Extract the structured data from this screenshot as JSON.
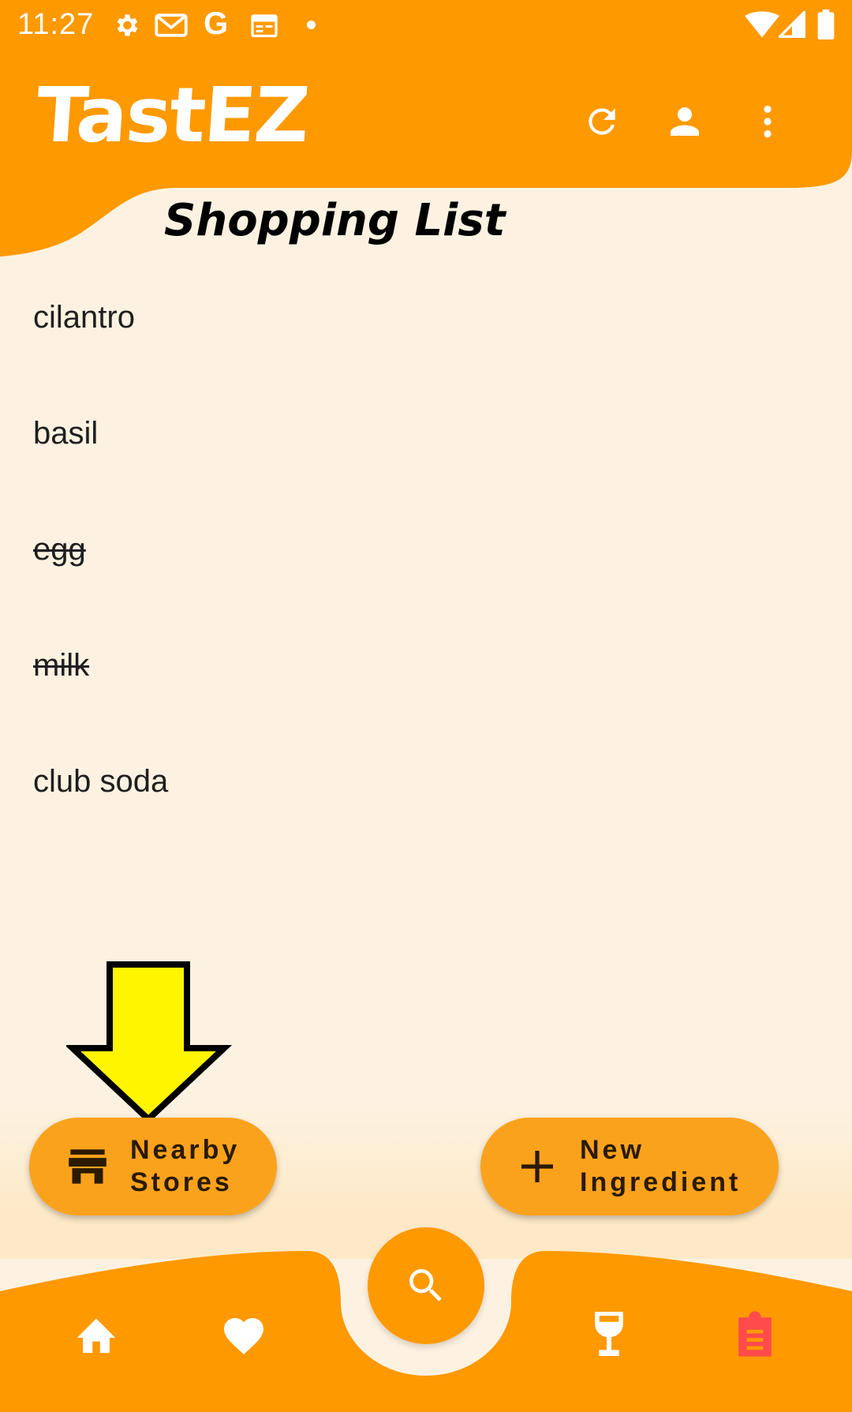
{
  "status_bar": {
    "time": "11:27"
  },
  "header": {
    "logo": "TastEZ",
    "refresh_icon": "refresh-icon",
    "account_icon": "person-icon",
    "menu_icon": "more-vert-icon"
  },
  "page": {
    "title": "Shopping List"
  },
  "list": {
    "items": [
      {
        "label": "cilantro",
        "checked": false
      },
      {
        "label": "basil",
        "checked": false
      },
      {
        "label": "egg",
        "checked": true
      },
      {
        "label": "milk",
        "checked": true
      },
      {
        "label": "club soda",
        "checked": false
      }
    ]
  },
  "fabs": {
    "nearby_line1": "Nearby",
    "nearby_line2": "Stores",
    "new_line1": "New",
    "new_line2": "Ingredient"
  },
  "bottom_nav": {
    "items": [
      "home-icon",
      "heart-icon",
      "search-icon",
      "wine-glass-icon",
      "clipboard-list-icon"
    ],
    "active": "clipboard-list-icon"
  },
  "colors": {
    "primary": "#FF9900",
    "background": "#FDF2E1",
    "fab": "#FBA21D",
    "active_nav": "#FF4B4B",
    "annotation_arrow": "#FFF500"
  }
}
